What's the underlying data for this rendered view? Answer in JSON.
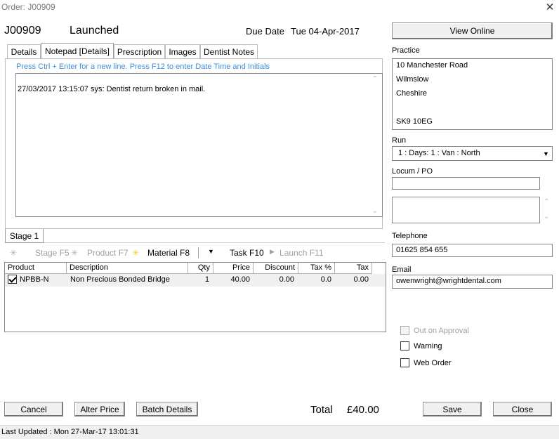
{
  "window": {
    "title": "Order: J00909"
  },
  "header": {
    "order_no": "J00909",
    "status": "Launched",
    "due_label": "Due Date",
    "due_value": "Tue 04-Apr-2017"
  },
  "tabs": [
    {
      "label": "Details"
    },
    {
      "label": "Notepad [Details]"
    },
    {
      "label": "Prescription"
    },
    {
      "label": "Images"
    },
    {
      "label": "Dentist Notes"
    }
  ],
  "notepad": {
    "hint": "Press Ctrl + Enter for a new line.  Press F12 to enter Date Time and Initials",
    "text": "27/03/2017 13:15:07 sys: Dentist return broken in mail."
  },
  "stage_tab": "Stage 1",
  "toolbar": {
    "stage": "Stage F5",
    "product": "Product F7",
    "material": "Material F8",
    "task": "Task F10",
    "launch": "Launch F11"
  },
  "grid": {
    "columns": [
      "Product",
      "Description",
      "Qty",
      "Price",
      "Discount",
      "Tax %",
      "Tax"
    ],
    "rows": [
      {
        "checked": true,
        "product": "NPBB-N",
        "description": "Non Precious Bonded Bridge",
        "qty": "1",
        "price": "40.00",
        "discount": "0.00",
        "tax_pct": "0.0",
        "tax": "0.00"
      }
    ]
  },
  "right": {
    "view_online": "View Online",
    "practice_label": "Practice",
    "address": [
      "10 Manchester Road",
      "Wilmslow",
      "Cheshire",
      "",
      "SK9 10EG"
    ],
    "run_label": "Run",
    "run_value": "1 : Days: 1 : Van : North",
    "locum_label": "Locum / PO",
    "locum_value": "",
    "locum_notes": "",
    "telephone_label": "Telephone",
    "telephone": "01625 854 655",
    "email_label": "Email",
    "email": "owenwright@wrightdental.com",
    "checkboxes": {
      "out_on_approval": "Out on Approval",
      "warning": "Warning",
      "web_order": "Web Order"
    }
  },
  "footer": {
    "cancel": "Cancel",
    "alter_price": "Alter Price",
    "batch_details": "Batch Details",
    "total_label": "Total",
    "total_value": "£40.00",
    "save": "Save",
    "close": "Close"
  },
  "statusbar": {
    "text": "Last Updated : Mon 27-Mar-17 13:01:31"
  }
}
